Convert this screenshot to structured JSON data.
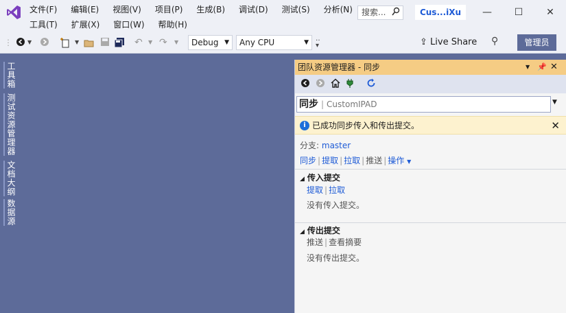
{
  "menu": {
    "row1": [
      "文件(F)",
      "编辑(E)",
      "视图(V)",
      "项目(P)",
      "生成(B)",
      "调试(D)",
      "测试(S)",
      "分析(N)"
    ],
    "row2": [
      "工具(T)",
      "扩展(X)",
      "窗口(W)",
      "帮助(H)"
    ]
  },
  "search": {
    "placeholder": "搜索...",
    "icon": "search-icon"
  },
  "solution_title": "Cus...iXu",
  "window_controls": {
    "minimize": "—",
    "maximize": "☐",
    "close": "✕"
  },
  "toolbar": {
    "config": "Debug",
    "platform": "Any CPU",
    "live_share": "Live Share",
    "admin": "管理员"
  },
  "left_tabs": [
    "工具箱",
    "测试资源管理器",
    "文档大纲",
    "数据源"
  ],
  "team_explorer": {
    "title": "团队资源管理器 - 同步",
    "page": "同步",
    "repo": "CustomIPAD",
    "notice": "已成功同步传入和传出提交。",
    "branch_label": "分支:",
    "branch": "master",
    "actions": [
      "同步",
      "提取",
      "拉取",
      "推送"
    ],
    "actions_menu": "操作",
    "incoming": {
      "title": "传入提交",
      "links": [
        "提取",
        "拉取"
      ],
      "empty": "没有传入提交。"
    },
    "outgoing": {
      "title": "传出提交",
      "links": [
        "推送",
        "查看摘要"
      ],
      "empty": "没有传出提交。"
    }
  },
  "colors": {
    "accent": "#5d6b99",
    "panel_title": "#f5cc84",
    "link": "#1e5bd6",
    "notice_bg": "#fdf2cf"
  }
}
